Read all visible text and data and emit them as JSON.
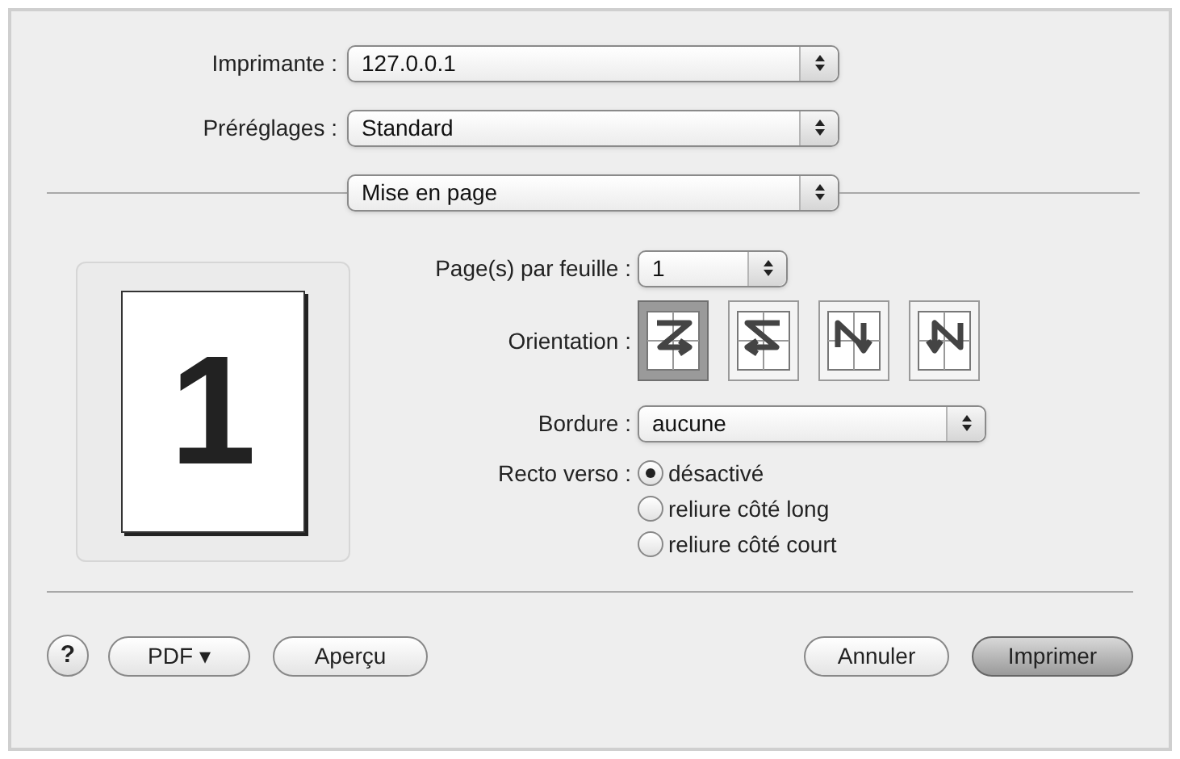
{
  "printer": {
    "label": "Imprimante :",
    "value": "127.0.0.1"
  },
  "presets": {
    "label": "Préréglages :",
    "value": "Standard"
  },
  "panel": {
    "value": "Mise en page"
  },
  "preview": {
    "page_number": "1"
  },
  "pages_per_sheet": {
    "label": "Page(s) par feuille :",
    "value": "1"
  },
  "orientation": {
    "label": "Orientation :",
    "options": [
      {
        "kind": "z",
        "selected": true
      },
      {
        "kind": "s",
        "selected": false
      },
      {
        "kind": "n-down",
        "selected": false
      },
      {
        "kind": "n-up",
        "selected": false
      }
    ]
  },
  "border": {
    "label": "Bordure :",
    "value": "aucune"
  },
  "duplex": {
    "label": "Recto verso :",
    "options": [
      {
        "label": "désactivé",
        "selected": true
      },
      {
        "label": "reliure côté long",
        "selected": false
      },
      {
        "label": "reliure côté court",
        "selected": false
      }
    ]
  },
  "buttons": {
    "help": "?",
    "pdf": "PDF ▾",
    "preview": "Aperçu",
    "cancel": "Annuler",
    "print": "Imprimer"
  }
}
